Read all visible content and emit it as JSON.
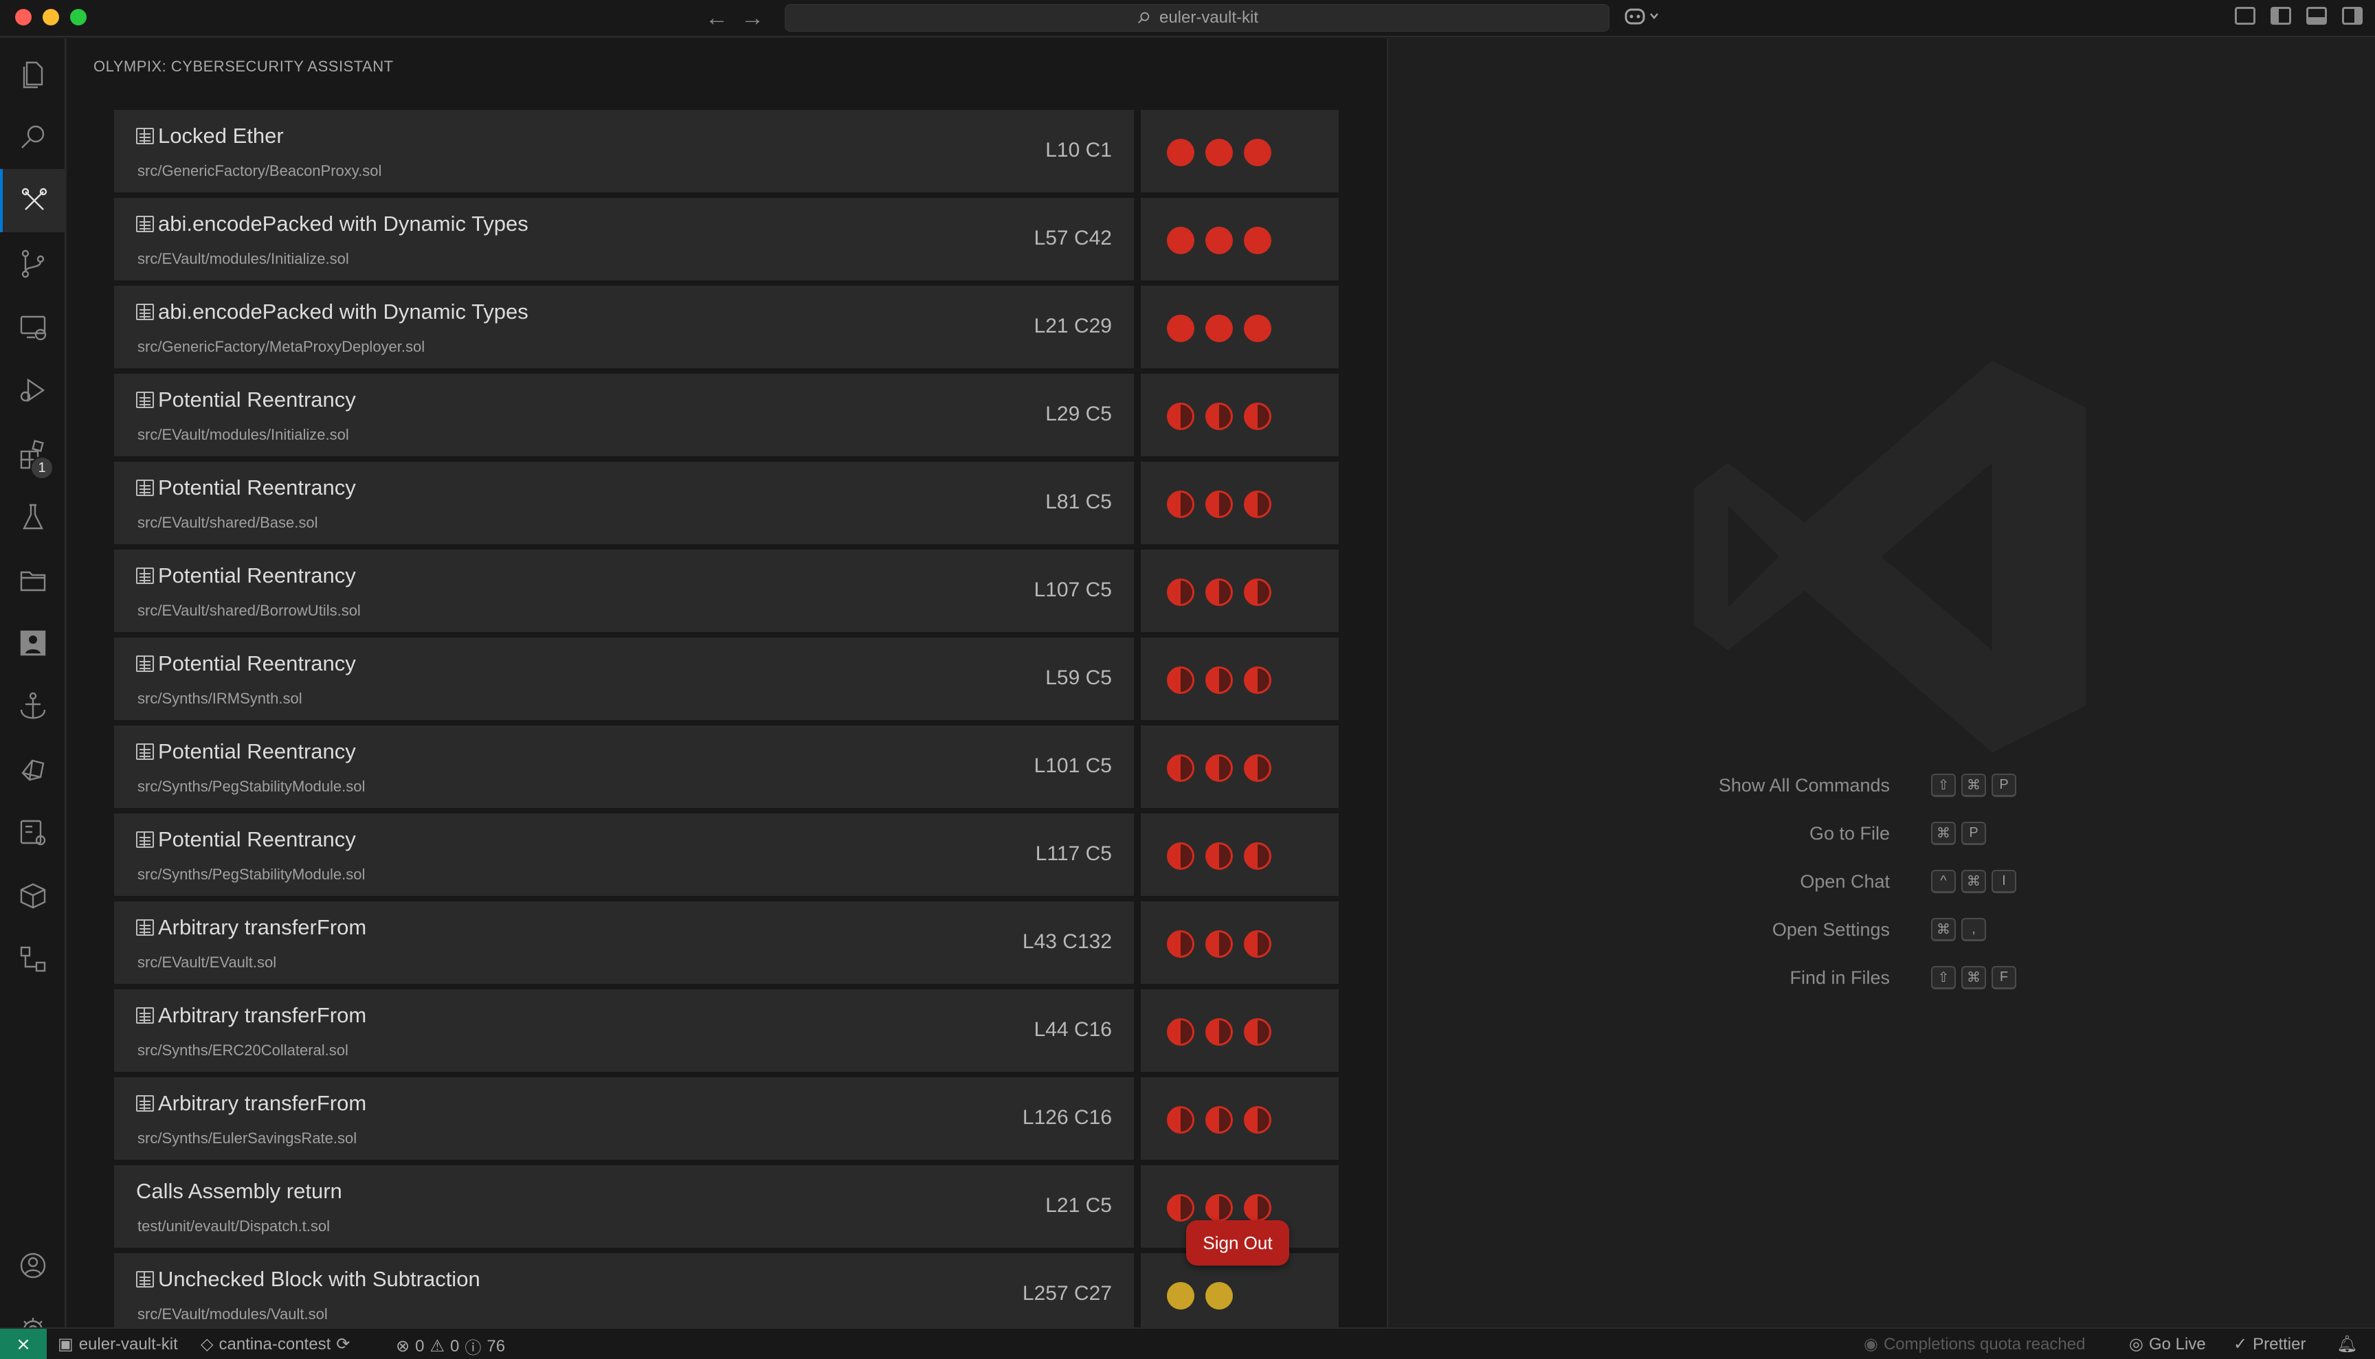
{
  "titlebar": {
    "back": "←",
    "forward": "→",
    "search_text": "euler-vault-kit"
  },
  "activity_bar": {
    "items": [
      {
        "name": "explorer-icon"
      },
      {
        "name": "search-icon"
      },
      {
        "name": "olympix-icon",
        "active": true
      },
      {
        "name": "source-control-icon"
      },
      {
        "name": "remote-explorer-icon"
      },
      {
        "name": "run-debug-icon"
      },
      {
        "name": "extensions-icon",
        "badge": "1"
      },
      {
        "name": "testing-icon"
      },
      {
        "name": "folder-icon"
      },
      {
        "name": "profile-card-icon"
      },
      {
        "name": "anchor-icon"
      },
      {
        "name": "docker-icon"
      },
      {
        "name": "remote-settings-icon"
      },
      {
        "name": "package-icon"
      },
      {
        "name": "diagram-icon"
      }
    ],
    "bottom": [
      {
        "name": "account-icon"
      },
      {
        "name": "manage-gear-icon"
      }
    ]
  },
  "panel": {
    "title": "OLYMPIX: CYBERSECURITY ASSISTANT",
    "findings": [
      {
        "title": "Locked Ether",
        "path": "src/GenericFactory/BeaconProxy.sol",
        "loc": "L10 C1",
        "severity": "high",
        "icon": true
      },
      {
        "title": "abi.encodePacked with Dynamic Types",
        "path": "src/EVault/modules/Initialize.sol",
        "loc": "L57 C42",
        "severity": "high",
        "icon": true
      },
      {
        "title": "abi.encodePacked with Dynamic Types",
        "path": "src/GenericFactory/MetaProxyDeployer.sol",
        "loc": "L21 C29",
        "severity": "high",
        "icon": true
      },
      {
        "title": "Potential Reentrancy",
        "path": "src/EVault/modules/Initialize.sol",
        "loc": "L29 C5",
        "severity": "medium",
        "icon": true
      },
      {
        "title": "Potential Reentrancy",
        "path": "src/EVault/shared/Base.sol",
        "loc": "L81 C5",
        "severity": "medium",
        "icon": true
      },
      {
        "title": "Potential Reentrancy",
        "path": "src/EVault/shared/BorrowUtils.sol",
        "loc": "L107 C5",
        "severity": "medium",
        "icon": true
      },
      {
        "title": "Potential Reentrancy",
        "path": "src/Synths/IRMSynth.sol",
        "loc": "L59 C5",
        "severity": "medium",
        "icon": true
      },
      {
        "title": "Potential Reentrancy",
        "path": "src/Synths/PegStabilityModule.sol",
        "loc": "L101 C5",
        "severity": "medium",
        "icon": true
      },
      {
        "title": "Potential Reentrancy",
        "path": "src/Synths/PegStabilityModule.sol",
        "loc": "L117 C5",
        "severity": "medium",
        "icon": true
      },
      {
        "title": "Arbitrary transferFrom",
        "path": "src/EVault/EVault.sol",
        "loc": "L43 C132",
        "severity": "medium",
        "icon": true
      },
      {
        "title": "Arbitrary transferFrom",
        "path": "src/Synths/ERC20Collateral.sol",
        "loc": "L44 C16",
        "severity": "medium",
        "icon": true
      },
      {
        "title": "Arbitrary transferFrom",
        "path": "src/Synths/EulerSavingsRate.sol",
        "loc": "L126 C16",
        "severity": "medium",
        "icon": true
      },
      {
        "title": "Calls Assembly return",
        "path": "test/unit/evault/Dispatch.t.sol",
        "loc": "L21 C5",
        "severity": "medium",
        "icon": false
      },
      {
        "title": "Unchecked Block with Subtraction",
        "path": "src/EVault/modules/Vault.sol",
        "loc": "L257 C27",
        "severity": "low",
        "icon": true
      }
    ],
    "sign_out": "Sign Out"
  },
  "editor": {
    "shortcuts": [
      {
        "label": "Show All Commands",
        "keys": [
          "⇧",
          "⌘",
          "P"
        ]
      },
      {
        "label": "Go to File",
        "keys": [
          "⌘",
          "P"
        ]
      },
      {
        "label": "Open Chat",
        "keys": [
          "^",
          "⌘",
          "I"
        ]
      },
      {
        "label": "Open Settings",
        "keys": [
          "⌘",
          ","
        ]
      },
      {
        "label": "Find in Files",
        "keys": [
          "⇧",
          "⌘",
          "F"
        ]
      }
    ]
  },
  "statusbar": {
    "remote": "⨯",
    "repo": "euler-vault-kit",
    "branch": "cantina-contest",
    "errors": "0",
    "warnings": "0",
    "info": "76",
    "completions": "Completions quota reached",
    "go_live": "Go Live",
    "prettier": "Prettier"
  },
  "colors": {
    "severity_high": "#d12c1f",
    "severity_low": "#c9a227",
    "signout": "#b3201b",
    "remote": "#16825d"
  }
}
